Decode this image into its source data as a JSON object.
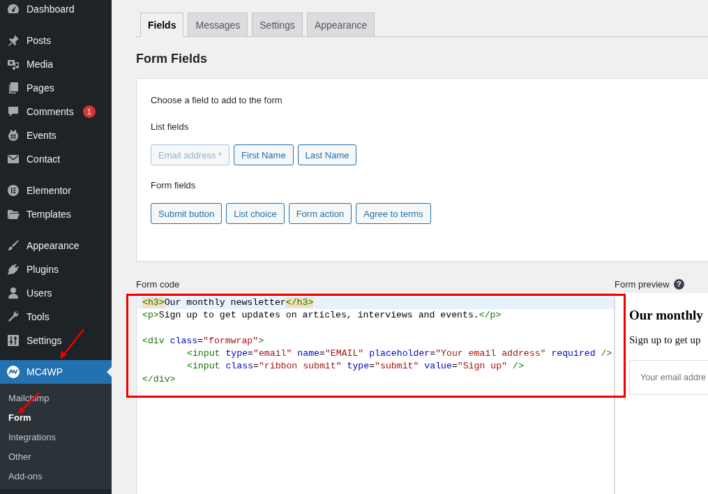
{
  "sidebar": {
    "groups": [
      [
        {
          "label": "Dashboard",
          "current": false
        }
      ],
      [
        {
          "label": "Posts",
          "current": false
        },
        {
          "label": "Media",
          "current": false
        },
        {
          "label": "Pages",
          "current": false
        },
        {
          "label": "Comments",
          "current": false,
          "badge": "1"
        },
        {
          "label": "Events",
          "current": false
        },
        {
          "label": "Contact",
          "current": false
        }
      ],
      [
        {
          "label": "Elementor",
          "current": false
        },
        {
          "label": "Templates",
          "current": false
        }
      ],
      [
        {
          "label": "Appearance",
          "current": false
        },
        {
          "label": "Plugins",
          "current": false
        },
        {
          "label": "Users",
          "current": false
        },
        {
          "label": "Tools",
          "current": false
        },
        {
          "label": "Settings",
          "current": false
        }
      ],
      [
        {
          "label": "MC4WP",
          "current": true,
          "children": [
            {
              "label": "Mailchimp",
              "selected": false
            },
            {
              "label": "Form",
              "selected": true
            },
            {
              "label": "Integrations",
              "selected": false
            },
            {
              "label": "Other",
              "selected": false
            },
            {
              "label": "Add-ons",
              "selected": false
            }
          ]
        }
      ]
    ]
  },
  "tabs": [
    {
      "label": "Fields",
      "selected": true
    },
    {
      "label": "Messages",
      "selected": false
    },
    {
      "label": "Settings",
      "selected": false
    },
    {
      "label": "Appearance",
      "selected": false
    }
  ],
  "heading": "Form Fields",
  "fields_panel": {
    "intro": "Choose a field to add to the form",
    "sections": [
      {
        "title": "List fields",
        "buttons": [
          {
            "label": "Email address *",
            "disabled": true
          },
          {
            "label": "First Name",
            "disabled": false
          },
          {
            "label": "Last Name",
            "disabled": false
          }
        ]
      },
      {
        "title": "Form fields",
        "buttons": [
          {
            "label": "Submit button",
            "disabled": false
          },
          {
            "label": "List choice",
            "disabled": false
          },
          {
            "label": "Form action",
            "disabled": false
          },
          {
            "label": "Agree to terms",
            "disabled": false
          }
        ]
      }
    ]
  },
  "form_code": {
    "label": "Form code",
    "lines": [
      {
        "highlighted": true,
        "indented": false,
        "tokens": [
          {
            "kind": "matched-tag",
            "text": "<h3>"
          },
          {
            "kind": "text",
            "text": "Our monthly newsletter"
          },
          {
            "kind": "matched-tag",
            "text": "</h3>"
          }
        ]
      },
      {
        "highlighted": false,
        "indented": false,
        "tokens": [
          {
            "kind": "tag",
            "text": "<p>"
          },
          {
            "kind": "text",
            "text": "Sign up to get updates on articles, interviews and events."
          },
          {
            "kind": "tag",
            "text": "</p>"
          }
        ]
      },
      {
        "kind": "blank"
      },
      {
        "highlighted": false,
        "indented": false,
        "tokens": [
          {
            "kind": "tag",
            "text": "<div"
          },
          {
            "kind": "attr",
            "text": " class"
          },
          {
            "kind": "text",
            "text": "="
          },
          {
            "kind": "value",
            "text": "\"formwrap\""
          },
          {
            "kind": "tag",
            "text": ">"
          }
        ]
      },
      {
        "highlighted": false,
        "indented": true,
        "tokens": [
          {
            "kind": "tag",
            "text": "<input"
          },
          {
            "kind": "attr",
            "text": " type"
          },
          {
            "kind": "text",
            "text": "="
          },
          {
            "kind": "value",
            "text": "\"email\""
          },
          {
            "kind": "attr",
            "text": " name"
          },
          {
            "kind": "text",
            "text": "="
          },
          {
            "kind": "value",
            "text": "\"EMAIL\""
          },
          {
            "kind": "attr",
            "text": " placeholder"
          },
          {
            "kind": "text",
            "text": "="
          },
          {
            "kind": "value",
            "text": "\"Your email address\""
          },
          {
            "kind": "attr",
            "text": " required"
          },
          {
            "kind": "tag",
            "text": " />"
          }
        ]
      },
      {
        "highlighted": false,
        "indented": true,
        "tokens": [
          {
            "kind": "tag",
            "text": "<input"
          },
          {
            "kind": "attr",
            "text": " class"
          },
          {
            "kind": "text",
            "text": "="
          },
          {
            "kind": "value",
            "text": "\"ribbon submit\""
          },
          {
            "kind": "attr",
            "text": " type"
          },
          {
            "kind": "text",
            "text": "="
          },
          {
            "kind": "value",
            "text": "\"submit\""
          },
          {
            "kind": "attr",
            "text": " value"
          },
          {
            "kind": "text",
            "text": "="
          },
          {
            "kind": "value",
            "text": "\"Sign up\""
          },
          {
            "kind": "tag",
            "text": " />"
          }
        ]
      },
      {
        "highlighted": false,
        "indented": false,
        "tokens": [
          {
            "kind": "tag",
            "text": "</div>"
          }
        ]
      }
    ]
  },
  "form_preview": {
    "label": "Form preview",
    "help_icon": "?",
    "heading": "Our monthly",
    "text": "Sign up to get up",
    "placeholder": "Your email addre"
  },
  "annotations": [
    {
      "kind": "box"
    },
    {
      "kind": "arrow"
    },
    {
      "kind": "arrow"
    }
  ]
}
